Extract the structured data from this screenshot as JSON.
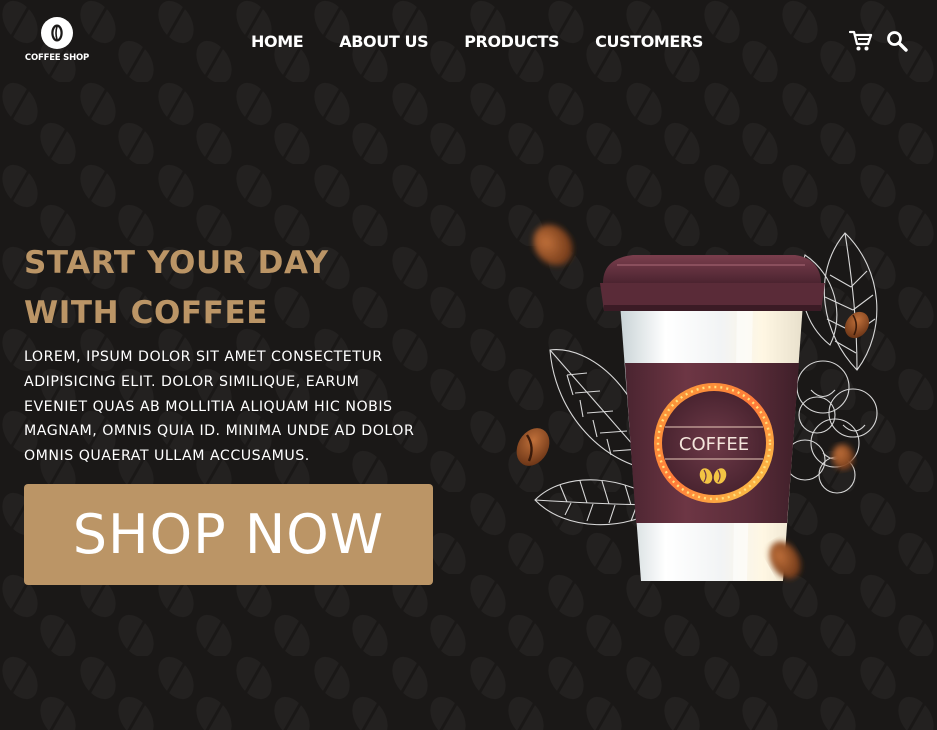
{
  "brand": {
    "name": "COFFEE SHOP",
    "accent": "#bb9566",
    "background": "#1a1817"
  },
  "nav": {
    "items": [
      {
        "label": "HOME"
      },
      {
        "label": "ABOUT US"
      },
      {
        "label": "PRODUCTS"
      },
      {
        "label": "CUSTOMERS"
      }
    ]
  },
  "header_icons": {
    "cart": "cart-icon",
    "search": "search-icon"
  },
  "hero": {
    "title_lines": [
      "START YOUR DAY",
      "WITH COFFEE"
    ],
    "text_lines": [
      "LOREM, IPSUM DOLOR SIT AMET CONSECTETUR",
      "ADIPISICING ELIT. DOLOR SIMILIQUE, EARUM",
      "EVENIET QUAS AB MOLLITIA ALIQUAM HIC NOBIS",
      "MAGNAM, OMNIS QUIA ID. MINIMA UNDE AD DOLOR",
      "OMNIS QUAERAT ULLAM ACCUSAMUS."
    ],
    "cta_label": "SHOP NOW",
    "cup_label": "COFFEE"
  }
}
